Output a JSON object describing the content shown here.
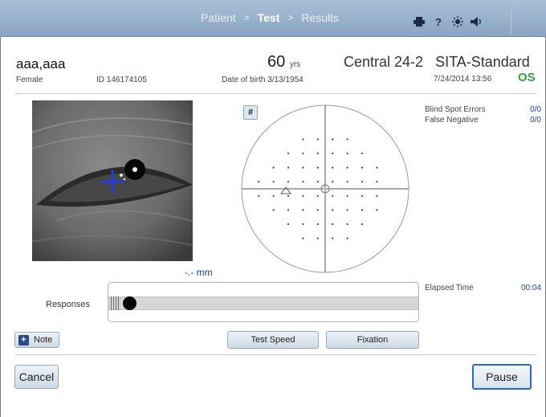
{
  "nav": {
    "crumbs": [
      "Patient",
      "Test",
      "Results"
    ],
    "separator": ">",
    "active_index": 1,
    "tools": [
      "printer-icon",
      "help-icon",
      "brightness-icon",
      "volume-icon",
      "wrench-icon",
      "close-icon"
    ],
    "help_glyph": "?"
  },
  "patient": {
    "name": "aaa,aaa",
    "sex": "Female",
    "id": "ID 146174105",
    "age": "60",
    "age_unit": "yrs",
    "dob": "Date of birth  3/13/1954"
  },
  "test": {
    "program": "Central 24-2",
    "strategy": "SITA-Standard",
    "datetime": "7/24/2014 13:56",
    "eye": "OS"
  },
  "eye_monitor": {
    "measurement": "-.- mm"
  },
  "grid_button": "#",
  "stats": [
    {
      "label": "Blind Spot Errors",
      "value": "0/0"
    },
    {
      "label": "False Negative",
      "value": "0/0"
    }
  ],
  "elapsed": {
    "label": "Elapsed Time",
    "value": "00:04"
  },
  "responses": {
    "label": "Responses"
  },
  "buttons": {
    "note": "Note",
    "test_speed": "Test Speed",
    "fixation": "Fixation",
    "cancel": "Cancel",
    "pause": "Pause"
  },
  "colors": {
    "accent": "#2a6bc2",
    "eye_label": "#2fa33a",
    "value_blue": "#1d3f9c",
    "topbar": "#8aa5c2"
  }
}
